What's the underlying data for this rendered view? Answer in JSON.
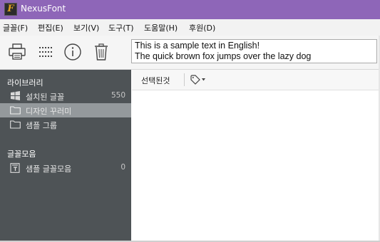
{
  "window": {
    "title": "NexusFont",
    "logo_letter": "F"
  },
  "menu": [
    {
      "label": "글꼴(F)"
    },
    {
      "label": "편집(E)"
    },
    {
      "label": "보기(V)"
    },
    {
      "label": "도구(T)"
    },
    {
      "label": "도움말(H)"
    },
    {
      "label": "후원(D)"
    }
  ],
  "toolbar": {
    "icons": [
      "printer-icon",
      "grid-icon",
      "info-icon",
      "trash-icon"
    ]
  },
  "sample_text": {
    "line1": "This is a sample text in English!",
    "line2": "The quick brown fox jumps over the lazy dog"
  },
  "sidebar": {
    "library_heading": "라이브러리",
    "library_items": [
      {
        "label": "설치된 글꼴",
        "count": "550",
        "icon": "windows-icon",
        "selected": false
      },
      {
        "label": "디자인 꾸러미",
        "count": "",
        "icon": "folder-icon",
        "selected": true
      },
      {
        "label": "샘플 그룹",
        "count": "",
        "icon": "folder-icon",
        "selected": false
      }
    ],
    "collection_heading": "글꼴모음",
    "collection_items": [
      {
        "label": "샘플 글꼴모음",
        "count": "0",
        "icon": "collection-icon",
        "selected": false
      }
    ]
  },
  "main": {
    "selected_tab_label": "선택된것",
    "tag_menu_icon": "tag-icon"
  },
  "colors": {
    "titlebar": "#8e66b8",
    "sidebar": "#4e5356",
    "sidebar_selected": "#94999c"
  }
}
